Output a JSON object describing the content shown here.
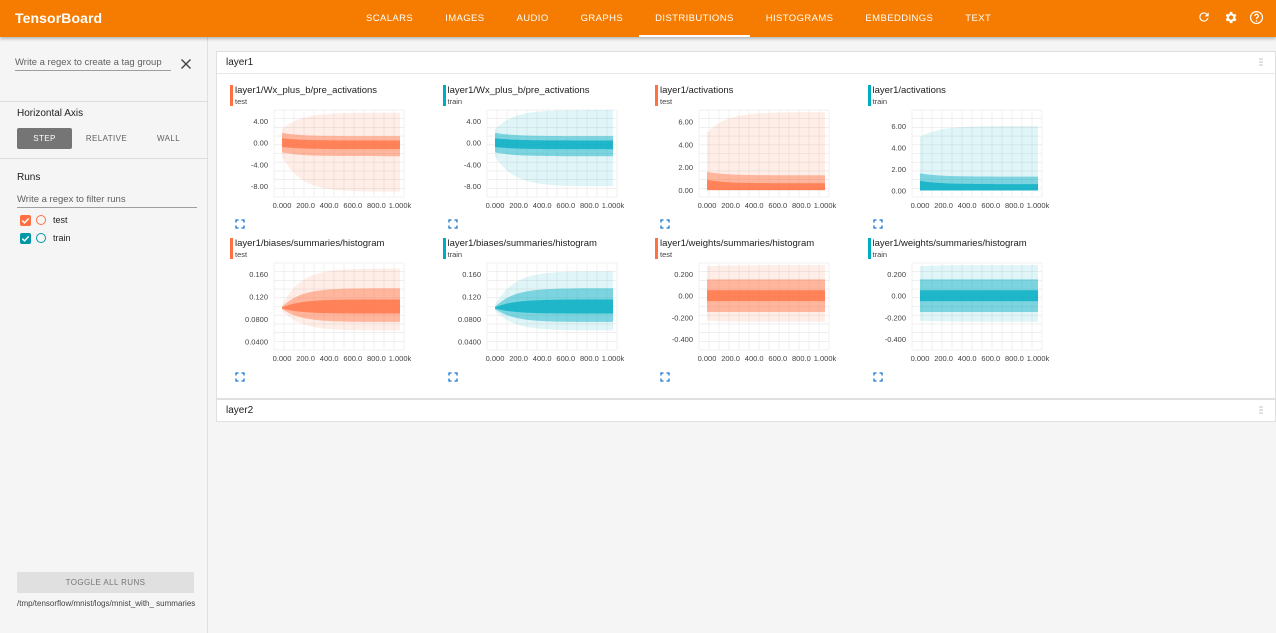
{
  "header": {
    "brand": "TensorBoard",
    "tabs": [
      {
        "label": "SCALARS"
      },
      {
        "label": "IMAGES"
      },
      {
        "label": "AUDIO"
      },
      {
        "label": "GRAPHS"
      },
      {
        "label": "DISTRIBUTIONS",
        "active": true
      },
      {
        "label": "HISTOGRAMS"
      },
      {
        "label": "EMBEDDINGS"
      },
      {
        "label": "TEXT"
      }
    ],
    "icons": [
      "refresh-icon",
      "settings-icon",
      "help-icon"
    ]
  },
  "sidebar": {
    "tag_placeholder": "Write a regex to create a tag group",
    "axis_title": "Horizontal Axis",
    "axis_options": [
      {
        "label": "STEP",
        "active": true
      },
      {
        "label": "RELATIVE"
      },
      {
        "label": "WALL"
      }
    ],
    "runs_title": "Runs",
    "runs_placeholder": "Write a regex to filter runs",
    "runs": [
      {
        "name": "test",
        "color": "#ff7043",
        "checked": true
      },
      {
        "name": "train",
        "color": "#0097a7",
        "checked": true
      }
    ],
    "toggle_label": "TOGGLE ALL RUNS",
    "logdir": "/tmp/tensorflow/mnist/logs/mnist_with_ summaries"
  },
  "colors": {
    "accent": "#f57c00",
    "test": "#ff7043",
    "train": "#00acc1"
  },
  "groups": [
    {
      "name": "layer1",
      "cards": [
        {
          "title": "layer1/Wx_plus_b/pre_activations",
          "run": "test",
          "chart_data": {
            "type": "area",
            "x": [
              0,
              1000
            ],
            "xticks": [
              "0.000",
              "200.0",
              "400.0",
              "600.0",
              "800.0",
              "1.000k"
            ],
            "yticks": [
              "4.00",
              "0.00",
              "-4.00",
              "-8.00"
            ],
            "ytick_values": [
              4,
              0,
              -4,
              -8
            ],
            "ylim": [
              -10,
              6
            ],
            "bands": {
              "outer_start": [
                -2.5,
                2.5
              ],
              "outer_end": [
                -9,
                5.5
              ],
              "mid_start": [
                -1.8,
                1.8
              ],
              "mid_end": [
                -2.5,
                1.2
              ],
              "inner_start": [
                -0.8,
                0.8
              ],
              "inner_end": [
                -1.2,
                0.4
              ]
            }
          }
        },
        {
          "title": "layer1/Wx_plus_b/pre_activations",
          "run": "train",
          "chart_data": {
            "type": "area",
            "x": [
              0,
              1000
            ],
            "xticks": [
              "0.000",
              "200.0",
              "400.0",
              "600.0",
              "800.0",
              "1.000k"
            ],
            "yticks": [
              "4.00",
              "0.00",
              "-4.00",
              "-8.00"
            ],
            "ytick_values": [
              4,
              0,
              -4,
              -8
            ],
            "ylim": [
              -10,
              6
            ],
            "bands": {
              "outer_start": [
                -2.5,
                2.5
              ],
              "outer_end": [
                -8,
                6
              ],
              "mid_start": [
                -1.8,
                1.8
              ],
              "mid_end": [
                -2.5,
                1.2
              ],
              "inner_start": [
                -0.8,
                0.8
              ],
              "inner_end": [
                -1.2,
                0.4
              ]
            }
          }
        },
        {
          "title": "layer1/activations",
          "run": "test",
          "chart_data": {
            "type": "area",
            "x": [
              0,
              1000
            ],
            "xticks": [
              "0.000",
              "200.0",
              "400.0",
              "600.0",
              "800.0",
              "1.000k"
            ],
            "yticks": [
              "6.00",
              "4.00",
              "2.00",
              "0.00"
            ],
            "ytick_values": [
              6,
              4,
              2,
              0
            ],
            "ylim": [
              -0.6,
              7
            ],
            "bands": {
              "outer_start": [
                0,
                5
              ],
              "outer_end": [
                0,
                6.8
              ],
              "mid_start": [
                0,
                1.6
              ],
              "mid_end": [
                0,
                1.3
              ],
              "inner_start": [
                0,
                0.9
              ],
              "inner_end": [
                0,
                0.6
              ]
            }
          }
        },
        {
          "title": "layer1/activations",
          "run": "train",
          "chart_data": {
            "type": "area",
            "x": [
              0,
              1000
            ],
            "xticks": [
              "0.000",
              "200.0",
              "400.0",
              "600.0",
              "800.0",
              "1.000k"
            ],
            "yticks": [
              "6.00",
              "4.00",
              "2.00",
              "0.00"
            ],
            "ytick_values": [
              6,
              4,
              2,
              0
            ],
            "ylim": [
              -0.6,
              7.5
            ],
            "bands": {
              "outer_start": [
                0,
                5
              ],
              "outer_end": [
                0,
                6
              ],
              "mid_start": [
                0,
                1.6
              ],
              "mid_end": [
                0,
                1.3
              ],
              "inner_start": [
                0,
                0.9
              ],
              "inner_end": [
                0,
                0.6
              ]
            }
          }
        },
        {
          "title": "layer1/biases/summaries/histogram",
          "run": "test",
          "chart_data": {
            "type": "area",
            "x": [
              0,
              1000
            ],
            "xticks": [
              "0.000",
              "200.0",
              "400.0",
              "600.0",
              "800.0",
              "1.000k"
            ],
            "yticks": [
              "0.160",
              "0.120",
              "0.0800",
              "0.0400"
            ],
            "ytick_values": [
              0.16,
              0.12,
              0.08,
              0.04
            ],
            "ylim": [
              0.025,
              0.18
            ],
            "bands": {
              "outer_start": [
                0.095,
                0.105
              ],
              "outer_end": [
                0.06,
                0.17
              ],
              "mid_start": [
                0.098,
                0.102
              ],
              "mid_end": [
                0.075,
                0.135
              ],
              "inner_start": [
                0.099,
                0.101
              ],
              "inner_end": [
                0.09,
                0.115
              ]
            }
          }
        },
        {
          "title": "layer1/biases/summaries/histogram",
          "run": "train",
          "chart_data": {
            "type": "area",
            "x": [
              0,
              1000
            ],
            "xticks": [
              "0.000",
              "200.0",
              "400.0",
              "600.0",
              "800.0",
              "1.000k"
            ],
            "yticks": [
              "0.160",
              "0.120",
              "0.0800",
              "0.0400"
            ],
            "ytick_values": [
              0.16,
              0.12,
              0.08,
              0.04
            ],
            "ylim": [
              0.025,
              0.18
            ],
            "bands": {
              "outer_start": [
                0.095,
                0.105
              ],
              "outer_end": [
                0.06,
                0.165
              ],
              "mid_start": [
                0.098,
                0.102
              ],
              "mid_end": [
                0.075,
                0.135
              ],
              "inner_start": [
                0.099,
                0.101
              ],
              "inner_end": [
                0.09,
                0.115
              ]
            }
          }
        },
        {
          "title": "layer1/weights/summaries/histogram",
          "run": "test",
          "chart_data": {
            "type": "area",
            "x": [
              0,
              1000
            ],
            "xticks": [
              "0.000",
              "200.0",
              "400.0",
              "600.0",
              "800.0",
              "1.000k"
            ],
            "yticks": [
              "0.200",
              "0.00",
              "-0.200",
              "-0.400"
            ],
            "ytick_values": [
              0.2,
              0,
              -0.2,
              -0.4
            ],
            "ylim": [
              -0.5,
              0.3
            ],
            "bands": {
              "outer_start": [
                -0.23,
                0.27
              ],
              "outer_end": [
                -0.24,
                0.28
              ],
              "mid_start": [
                -0.15,
                0.15
              ],
              "mid_end": [
                -0.15,
                0.15
              ],
              "inner_start": [
                -0.05,
                0.05
              ],
              "inner_end": [
                -0.05,
                0.05
              ]
            }
          }
        },
        {
          "title": "layer1/weights/summaries/histogram",
          "run": "train",
          "chart_data": {
            "type": "area",
            "x": [
              0,
              1000
            ],
            "xticks": [
              "0.000",
              "200.0",
              "400.0",
              "600.0",
              "800.0",
              "1.000k"
            ],
            "yticks": [
              "0.200",
              "0.00",
              "-0.200",
              "-0.400"
            ],
            "ytick_values": [
              0.2,
              0,
              -0.2,
              -0.4
            ],
            "ylim": [
              -0.5,
              0.3
            ],
            "bands": {
              "outer_start": [
                -0.23,
                0.27
              ],
              "outer_end": [
                -0.24,
                0.28
              ],
              "mid_start": [
                -0.15,
                0.15
              ],
              "mid_end": [
                -0.15,
                0.15
              ],
              "inner_start": [
                -0.05,
                0.05
              ],
              "inner_end": [
                -0.05,
                0.05
              ]
            }
          }
        }
      ]
    },
    {
      "name": "layer2",
      "cards": []
    }
  ]
}
